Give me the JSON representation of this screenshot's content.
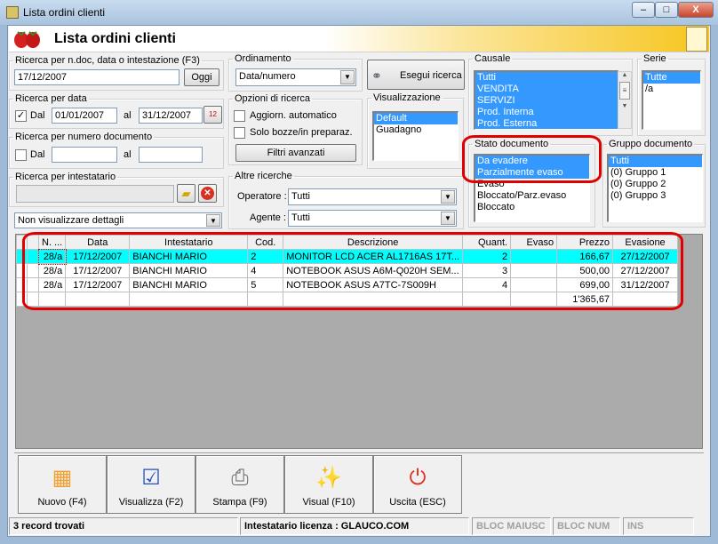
{
  "window": {
    "title": "Lista ordini clienti",
    "min": "–",
    "max": "□",
    "close": "X"
  },
  "header": {
    "title": "Lista ordini clienti"
  },
  "search": {
    "legend": "Ricerca per n.doc, data o intestazione (F3)",
    "value": "17/12/2007",
    "today_label": "Oggi"
  },
  "date_search": {
    "legend": "Ricerca per data",
    "checked": true,
    "check": "✓",
    "from_label": "Dal",
    "from": "01/01/2007",
    "to_label": "al",
    "to": "31/12/2007"
  },
  "num_search": {
    "legend": "Ricerca per numero documento",
    "from_label": "Dal",
    "from": "",
    "to_label": "al",
    "to": ""
  },
  "holder_search": {
    "legend": "Ricerca per intestatario",
    "value": ""
  },
  "details_select": {
    "value": "Non visualizzare dettagli"
  },
  "ordering": {
    "legend": "Ordinamento",
    "value": "Data/numero"
  },
  "options": {
    "legend": "Opzioni di ricerca",
    "auto_update": "Aggiorn. automatico",
    "drafts_only": "Solo bozze/in preparaz.",
    "advanced_filters": "Filtri avanzati"
  },
  "other": {
    "legend": "Altre ricerche",
    "operator_label": "Operatore :",
    "operator": "Tutti",
    "agent_label": "Agente :",
    "agent": "Tutti"
  },
  "run_search": "Esegui ricerca",
  "view": {
    "legend": "Visualizzazione",
    "items": [
      "Default",
      "Guadagno"
    ]
  },
  "causale": {
    "legend": "Causale",
    "items": [
      "Tutti",
      "VENDITA",
      "SERVIZI",
      "Prod. Interna",
      "Prod. Esterna"
    ]
  },
  "serie": {
    "legend": "Serie",
    "items": [
      "Tutte",
      "/a"
    ]
  },
  "stato": {
    "legend": "Stato documento",
    "items": [
      "Da evadere",
      "Parzialmente evaso",
      "Evaso",
      "Bloccato/Parz.evaso",
      "Bloccato"
    ]
  },
  "gruppo": {
    "legend": "Gruppo documento",
    "items": [
      "Tutti",
      "(0) Gruppo 1",
      "(0) Gruppo 2",
      "(0) Gruppo 3"
    ]
  },
  "table": {
    "columns": [
      "N. ...",
      "Data",
      "Intestatario",
      "Cod.",
      "Descrizione",
      "Quant.",
      "Evaso",
      "Prezzo",
      "Evasione"
    ],
    "rows": [
      [
        "28/a",
        "17/12/2007",
        "BIANCHI MARIO",
        "2",
        "MONITOR LCD ACER AL1716AS 17T...",
        "2",
        "",
        "166,67",
        "27/12/2007"
      ],
      [
        "28/a",
        "17/12/2007",
        "BIANCHI MARIO",
        "4",
        "NOTEBOOK ASUS A6M-Q020H SEM...",
        "3",
        "",
        "500,00",
        "27/12/2007"
      ],
      [
        "28/a",
        "17/12/2007",
        "BIANCHI MARIO",
        "5",
        "NOTEBOOK ASUS A7TC-7S009H",
        "4",
        "",
        "699,00",
        "31/12/2007"
      ]
    ],
    "total": "1'365,67"
  },
  "toolbar": [
    "Nuovo (F4)",
    "Visualizza (F2)",
    "Stampa (F9)",
    "Visual (F10)",
    "Uscita (ESC)"
  ],
  "status": {
    "records": "3 record trovati",
    "license": "Intestatario licenza : GLAUCO.COM",
    "caps": "BLOC MAIUSC",
    "num": "BLOC NUM",
    "ins": "INS"
  }
}
